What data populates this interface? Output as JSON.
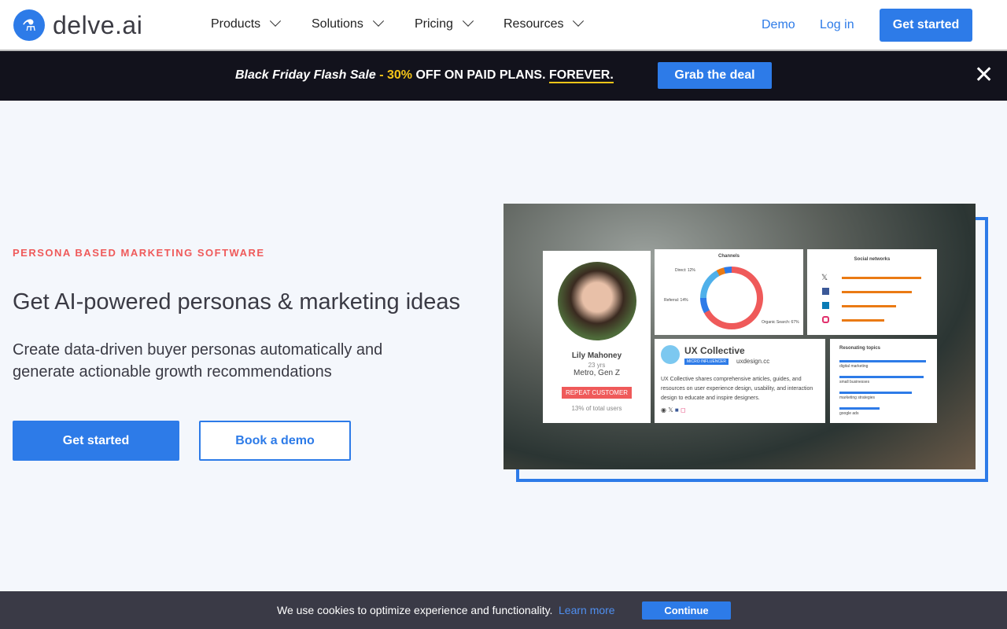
{
  "brand": {
    "name": "delve.ai",
    "icon": "microscope-icon"
  },
  "nav": {
    "items": [
      {
        "label": "Products"
      },
      {
        "label": "Solutions"
      },
      {
        "label": "Pricing"
      },
      {
        "label": "Resources"
      }
    ],
    "demo": "Demo",
    "login": "Log in",
    "get_started": "Get started"
  },
  "banner": {
    "lead": "Black Friday Flash Sale",
    "dash": "-",
    "percent": "30%",
    "off": "OFF ON PAID PLANS.",
    "forever": "FOREVER.",
    "cta": "Grab the deal"
  },
  "hero": {
    "eyebrow": "PERSONA BASED MARKETING SOFTWARE",
    "title": "Get AI-powered personas & marketing ideas",
    "subtitle": "Create data-driven buyer personas automatically and generate actionable growth recommendations",
    "primary": "Get started",
    "secondary": "Book a demo"
  },
  "persona": {
    "name": "Lily Mahoney",
    "age": "23 yrs",
    "segment": "Metro, Gen Z",
    "badge": "REPEAT CUSTOMER",
    "share": "13% of total users"
  },
  "channels": {
    "title": "Channels",
    "direct": "Direct: 12%",
    "referral": "Referral: 14%",
    "organic": "Organic Search: 67%"
  },
  "social": {
    "title": "Social networks",
    "items": [
      {
        "icon": "x-icon",
        "value": 0.95
      },
      {
        "icon": "facebook-icon",
        "value": 0.84
      },
      {
        "icon": "linkedin-icon",
        "value": 0.65
      },
      {
        "icon": "instagram-icon",
        "value": 0.51
      }
    ]
  },
  "influencer": {
    "name": "UX Collective",
    "tag": "MICRO INFLUENCER",
    "site": "uxdesign.cc",
    "desc": "UX Collective shares comprehensive articles, guides, and resources on user experience design, usability, and interaction design to educate and inspire designers."
  },
  "topics": {
    "title": "Resonating topics",
    "items": [
      {
        "label": "digital marketing",
        "value": 1.0
      },
      {
        "label": "small businesses",
        "value": 0.97
      },
      {
        "label": "marketing strategies",
        "value": 0.84
      },
      {
        "label": "google ads",
        "value": 0.46
      }
    ]
  },
  "cookie": {
    "text": "We use cookies to optimize experience and functionality.",
    "learn": "Learn more",
    "cta": "Continue"
  },
  "colors": {
    "accent": "#2d7be8",
    "sale": "#f5c518",
    "alert": "#ef5a5a"
  }
}
